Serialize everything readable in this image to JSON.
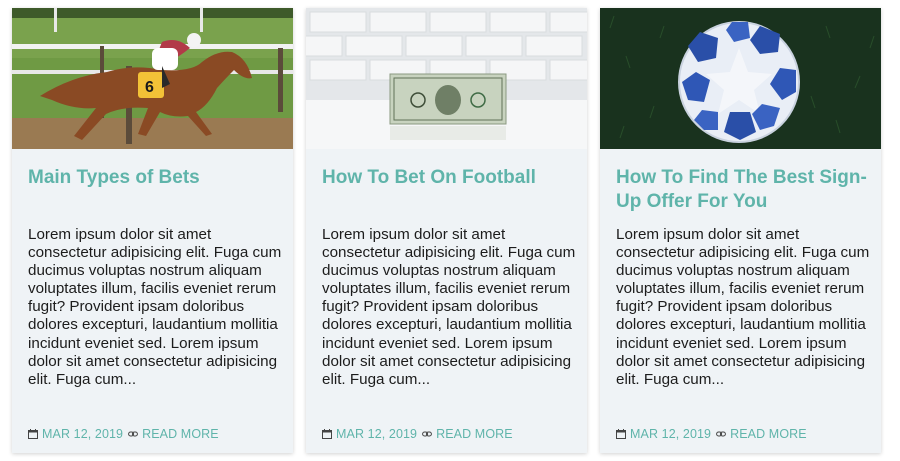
{
  "posts": [
    {
      "image_alt": "Jockey riding a racehorse",
      "title": "Main Types of Bets",
      "excerpt": "Lorem ipsum dolor sit amet consectetur adipisicing elit. Fuga cum ducimus voluptas nostrum aliquam voluptates illum, facilis eveniet rerum fugit? Provident ipsam doloribus dolores excepturi, laudantium mollitia incidunt eveniet sed. Lorem ipsum dolor sit amet consectetur adipisicing elit. Fuga cum...",
      "date": "MAR 12, 2019",
      "read_more": "READ MORE"
    },
    {
      "image_alt": "One dollar bill standing on a table",
      "title": "How To Bet On Football",
      "excerpt": "Lorem ipsum dolor sit amet consectetur adipisicing elit. Fuga cum ducimus voluptas nostrum aliquam voluptates illum, facilis eveniet rerum fugit? Provident ipsam doloribus dolores excepturi, laudantium mollitia incidunt eveniet sed. Lorem ipsum dolor sit amet consectetur adipisicing elit. Fuga cum...",
      "date": "MAR 12, 2019",
      "read_more": "READ MORE"
    },
    {
      "image_alt": "Football on grass",
      "title": "How To Find The Best Sign-Up Offer For You",
      "excerpt": "Lorem ipsum dolor sit amet consectetur adipisicing elit. Fuga cum ducimus voluptas nostrum aliquam voluptates illum, facilis eveniet rerum fugit? Provident ipsam doloribus dolores excepturi, laudantium mollitia incidunt eveniet sed. Lorem ipsum dolor sit amet consectetur adipisicing elit. Fuga cum...",
      "date": "MAR 12, 2019",
      "read_more": "READ MORE"
    }
  ],
  "icons": {
    "date": "calendar-icon",
    "read_more": "link-icon"
  },
  "colors": {
    "accent": "#5fb4aa",
    "card_bg": "#eff3f6",
    "text": "#1c1c1c"
  }
}
